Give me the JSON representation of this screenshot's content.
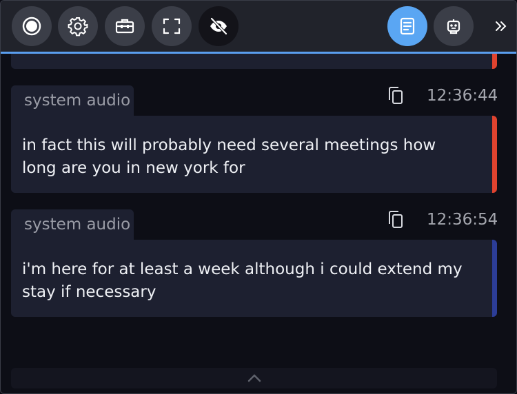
{
  "toolbar": {
    "buttons": [
      {
        "icon": "record-icon"
      },
      {
        "icon": "gear-icon"
      },
      {
        "icon": "toolbox-icon"
      },
      {
        "icon": "fullscreen-icon"
      },
      {
        "icon": "eye-off-icon"
      },
      {
        "icon": "transcript-icon",
        "active": true
      },
      {
        "icon": "robot-icon"
      }
    ],
    "expand_icon": "double-chevron-right-icon",
    "accent_color": "#5aa6f3"
  },
  "messages": [
    {
      "source": "system audio",
      "time": "12:36:44",
      "text": "in fact this will probably need several meetings how long are you in new york for",
      "marker_color": "#e0432f"
    },
    {
      "source": "system audio",
      "time": "12:36:54",
      "text": "i'm here for at least a week although i could extend my stay if necessary",
      "marker_color": "#2c3d97"
    }
  ],
  "footer": {
    "icon": "chevron-up-icon"
  }
}
